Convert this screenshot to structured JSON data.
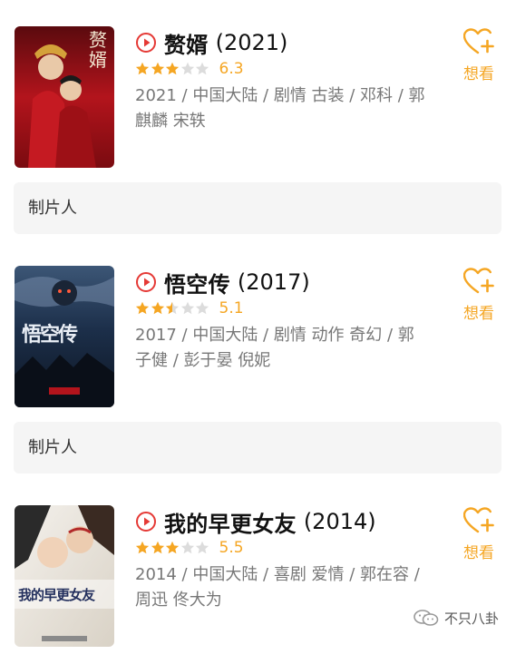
{
  "movies": [
    {
      "title": "赘婿",
      "year": "(2021)",
      "rating_stars": 3,
      "score": "6.3",
      "meta": "2021 / 中国大陆 / 剧情 古装 / 邓科 / 郭麒麟 宋轶",
      "want_label": "想看",
      "poster": {
        "text": "赘婿",
        "palette": [
          "#b3141c",
          "#7a0b10",
          "#e8c07a"
        ]
      }
    },
    {
      "title": "悟空传",
      "year": "(2017)",
      "rating_stars": 2.5,
      "score": "5.1",
      "meta": "2017 / 中国大陆 / 剧情 动作 奇幻 / 郭子健 / 彭于晏 倪妮",
      "want_label": "想看",
      "poster": {
        "text": "悟空传",
        "palette": [
          "#1c2f4a",
          "#0d1522",
          "#c9d3e0"
        ]
      }
    },
    {
      "title": "我的早更女友",
      "year": "(2014)",
      "rating_stars": 3,
      "score": "5.5",
      "meta": "2014 / 中国大陆 / 喜剧 爱情 / 郭在容 / 周迅 佟大为",
      "want_label": "想看",
      "poster": {
        "text": "我的早更女友",
        "palette": [
          "#e9e4dc",
          "#b22a2a",
          "#24305e"
        ]
      }
    }
  ],
  "producer_bars": [
    {
      "label": "制片人"
    },
    {
      "label": "制片人"
    }
  ],
  "colors": {
    "accent": "#f5a623",
    "play_red": "#e53935",
    "star_empty": "#dcdcdc",
    "meta_text": "#777777",
    "bar_bg": "#f5f5f5"
  },
  "icons": {
    "play": "play-circle-icon",
    "want": "heart-plus-icon",
    "star": "star-icon"
  },
  "watermark": {
    "text": "不只八卦",
    "icon": "wechat-icon"
  }
}
